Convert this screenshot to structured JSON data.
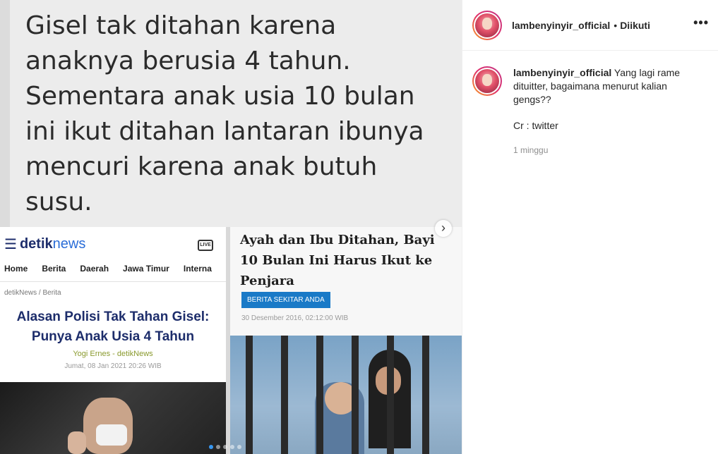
{
  "post_image": {
    "quote_text": "Gisel tak ditahan karena\nanaknya berusia 4 tahun.\nSementara anak usia 10 bulan\nini ikut ditahan lantaran ibunya\nmencuri karena anak butuh\nsusu.",
    "left_article": {
      "logo_brand": "detik",
      "logo_suffix": "news",
      "live_label": "LIVE",
      "nav_items": [
        "Home",
        "Berita",
        "Daerah",
        "Jawa Timur",
        "Interna"
      ],
      "breadcrumb": "detikNews / Berita",
      "headline": "Alasan Polisi Tak Tahan Gisel: Punya Anak Usia 4 Tahun",
      "byline": "Yogi Ernes - detikNews",
      "date": "Jumat, 08 Jan 2021 20:26 WIB"
    },
    "right_article": {
      "headline": "Ayah dan Ibu Ditahan, Bayi\n10 Bulan Ini Harus Ikut ke\nPenjara",
      "tag": "BERITA SEKITAR ANDA",
      "date": "30 Desember 2016, 02:12:00 WIB"
    },
    "carousel": {
      "current": 1,
      "total": 5
    }
  },
  "icons": {
    "next": "chevron-right-icon",
    "more": "more-horizontal-icon",
    "menu": "hamburger-icon",
    "live": "live-tv-icon"
  },
  "header": {
    "username": "lambenyinyir_official",
    "separator": "•",
    "follow_status": "Diikuti",
    "more_label": "•••"
  },
  "caption": {
    "username": "lambenyinyir_official",
    "text": "Yang lagi rame dituitter, bagaimana menurut kalian gengs??",
    "extra": "Cr : twitter",
    "time": "1 minggu"
  },
  "colors": {
    "accent": "#3897f0",
    "detik_navy": "#1d2d6b",
    "detik_blue": "#2a6dd8",
    "tag_blue": "#1a7ac7"
  }
}
